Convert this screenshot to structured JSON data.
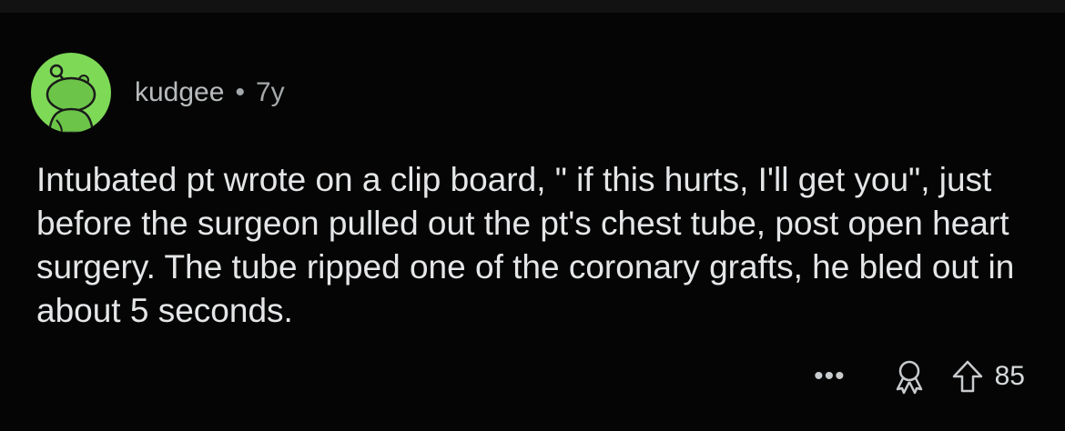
{
  "comment": {
    "username": "kudgee",
    "separator": "•",
    "age": "7y",
    "text": "Intubated pt wrote on a clip board, \" if this hurts, I'll get you\", just before the surgeon pulled out the pt's chest tube, post open heart surgery. The tube ripped one of the coronary grafts, he bled out in about 5 seconds.",
    "more_label": "•••",
    "score": "85"
  },
  "icons": {
    "avatar": "reddit-snoo-avatar",
    "award": "award-icon",
    "upvote": "upvote-arrow-icon"
  },
  "colors": {
    "background": "#000000",
    "avatar": "#7ed957",
    "text": "#e4e6e8",
    "meta": "#a5a8aa"
  }
}
